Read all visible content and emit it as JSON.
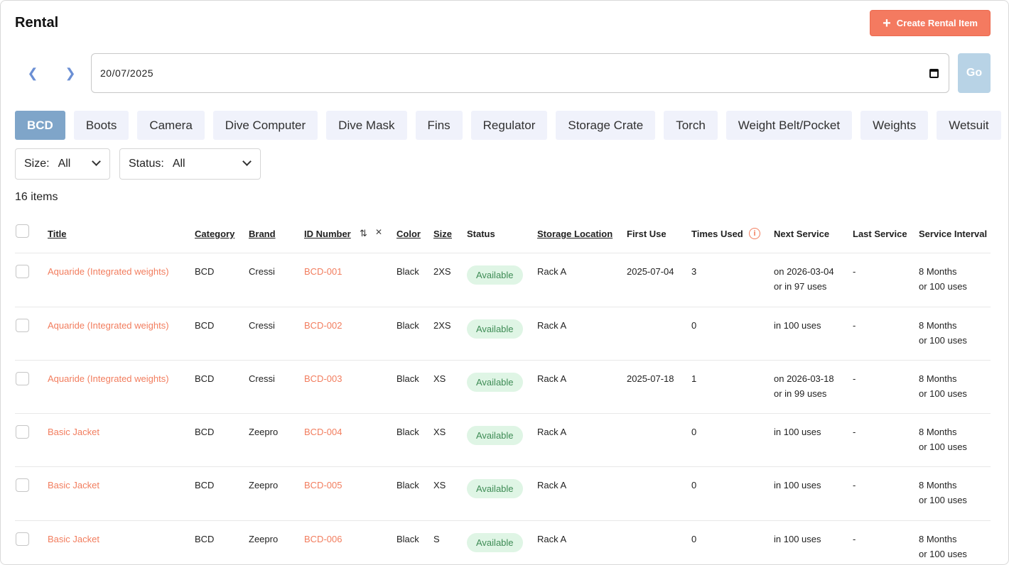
{
  "header": {
    "title": "Rental",
    "create_button": "Create Rental Item"
  },
  "date_bar": {
    "prev_icon": "chevron-left-icon",
    "next_icon": "chevron-right-icon",
    "date_value": "20/07/2025",
    "go_label": "Go"
  },
  "category_tabs": [
    "BCD",
    "Boots",
    "Camera",
    "Dive Computer",
    "Dive Mask",
    "Fins",
    "Regulator",
    "Storage Crate",
    "Torch",
    "Weight Belt/Pocket",
    "Weights",
    "Wetsuit"
  ],
  "active_category": "BCD",
  "filters": {
    "size": {
      "label": "Size:",
      "value": "All"
    },
    "status": {
      "label": "Status:",
      "value": "All"
    }
  },
  "item_count": "16 items",
  "columns": {
    "title": "Title",
    "category": "Category",
    "brand": "Brand",
    "id_number": "ID Number",
    "color": "Color",
    "size": "Size",
    "status": "Status",
    "storage_location": "Storage Location",
    "first_use": "First Use",
    "times_used": "Times Used",
    "next_service": "Next Service",
    "last_service": "Last Service",
    "service_interval": "Service Interval"
  },
  "rows": [
    {
      "title": "Aquaride (Integrated weights)",
      "category": "BCD",
      "brand": "Cressi",
      "id_number": "BCD-001",
      "color": "Black",
      "size": "2XS",
      "status": "Available",
      "storage_location": "Rack A",
      "first_use": "2025-07-04",
      "times_used": "3",
      "next_service_1": "on 2026-03-04",
      "next_service_2": "or in 97 uses",
      "last_service": "-",
      "service_interval_1": "8 Months",
      "service_interval_2": "or 100 uses"
    },
    {
      "title": "Aquaride (Integrated weights)",
      "category": "BCD",
      "brand": "Cressi",
      "id_number": "BCD-002",
      "color": "Black",
      "size": "2XS",
      "status": "Available",
      "storage_location": "Rack A",
      "first_use": "",
      "times_used": "0",
      "next_service_1": "in 100 uses",
      "next_service_2": "",
      "last_service": "-",
      "service_interval_1": "8 Months",
      "service_interval_2": "or 100 uses"
    },
    {
      "title": "Aquaride (Integrated weights)",
      "category": "BCD",
      "brand": "Cressi",
      "id_number": "BCD-003",
      "color": "Black",
      "size": "XS",
      "status": "Available",
      "storage_location": "Rack A",
      "first_use": "2025-07-18",
      "times_used": "1",
      "next_service_1": "on 2026-03-18",
      "next_service_2": "or in 99 uses",
      "last_service": "-",
      "service_interval_1": "8 Months",
      "service_interval_2": "or 100 uses"
    },
    {
      "title": "Basic Jacket",
      "category": "BCD",
      "brand": "Zeepro",
      "id_number": "BCD-004",
      "color": "Black",
      "size": "XS",
      "status": "Available",
      "storage_location": "Rack A",
      "first_use": "",
      "times_used": "0",
      "next_service_1": "in 100 uses",
      "next_service_2": "",
      "last_service": "-",
      "service_interval_1": "8 Months",
      "service_interval_2": "or 100 uses"
    },
    {
      "title": "Basic Jacket",
      "category": "BCD",
      "brand": "Zeepro",
      "id_number": "BCD-005",
      "color": "Black",
      "size": "XS",
      "status": "Available",
      "storage_location": "Rack A",
      "first_use": "",
      "times_used": "0",
      "next_service_1": "in 100 uses",
      "next_service_2": "",
      "last_service": "-",
      "service_interval_1": "8 Months",
      "service_interval_2": "or 100 uses"
    },
    {
      "title": "Basic Jacket",
      "category": "BCD",
      "brand": "Zeepro",
      "id_number": "BCD-006",
      "color": "Black",
      "size": "S",
      "status": "Available",
      "storage_location": "Rack A",
      "first_use": "",
      "times_used": "0",
      "next_service_1": "in 100 uses",
      "next_service_2": "",
      "last_service": "-",
      "service_interval_1": "8 Months",
      "service_interval_2": "or 100 uses"
    }
  ],
  "colors": {
    "accent": "#f47a60",
    "link": "#f27d5e",
    "active_tab": "#7fa5c9",
    "go_button": "#b8d3e6",
    "badge_bg": "#dff5e5",
    "badge_text": "#3e8c55"
  }
}
